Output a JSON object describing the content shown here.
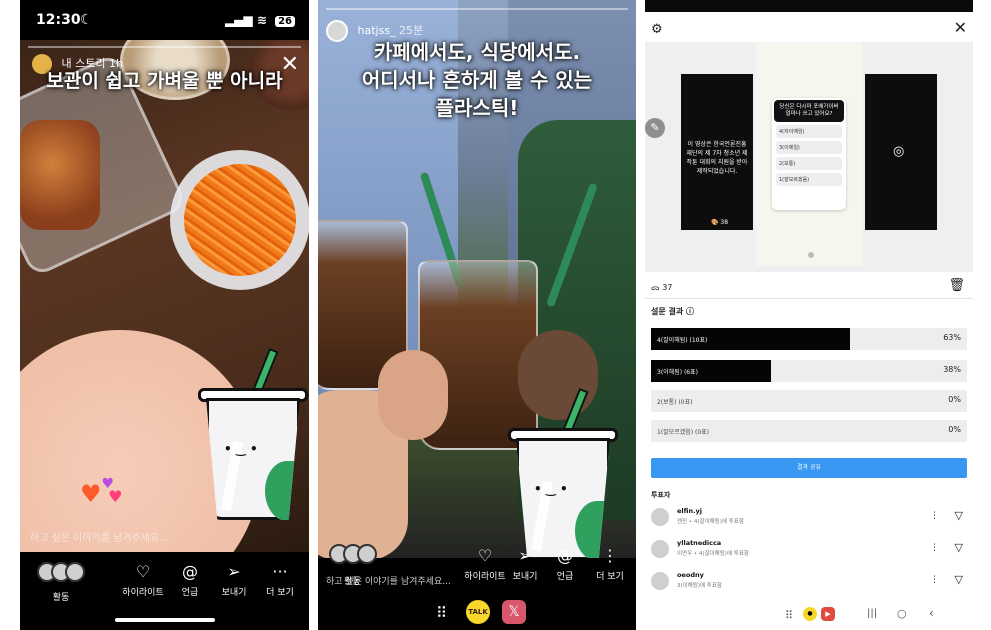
{
  "panel1": {
    "status": {
      "time": "12:30",
      "battery": "26"
    },
    "story_owner": "내 스토리",
    "story_time": "1h",
    "caption": "보관이 쉽고 가벼울 뿐 아니라",
    "message_placeholder": "하고 싶은 이야기를 남겨주세요...",
    "actions": [
      {
        "icon": "activity-avatars-icon",
        "label": "활동"
      },
      {
        "icon": "highlight-icon",
        "label": "하이라이트"
      },
      {
        "icon": "mention-icon",
        "label": "언급"
      },
      {
        "icon": "send-icon",
        "label": "보내기"
      },
      {
        "icon": "more-icon",
        "label": "더 보기"
      }
    ]
  },
  "panel2": {
    "username": "hatjss_",
    "time": "25분",
    "caption_lines": [
      "카페에서도, 식당에서도.",
      "어디서나 흔하게 볼 수 있는",
      "플라스틱!"
    ],
    "message_placeholder": "하고 싶은 이야기를 남겨주세요...",
    "activity_label": "활동",
    "actions": [
      {
        "icon": "highlight-icon",
        "label": "하이라이트"
      },
      {
        "icon": "send-icon",
        "label": "보내기"
      },
      {
        "icon": "mention-icon",
        "label": "언급"
      },
      {
        "icon": "more-icon",
        "label": "더 보기"
      }
    ],
    "nav": {
      "talk_label": "TALK"
    }
  },
  "panel3": {
    "thumb_left_text": "이 영상은 한국언론진흥재단의 제 7차 청소년 제작툰 대회의 지원을 받아 제작되었습니다.",
    "thumb_left_count": "🎨 38",
    "poll_question": "당신은 다시마 포에가이버 얼마나 쓰고 있어요?",
    "poll_options": [
      "4(자이예임)",
      "3(이메일)",
      "2(보통)",
      "1(잘모르겠음)"
    ],
    "views": "37",
    "results_title": "설문 결과",
    "results": [
      {
        "label": "4(잘이해됨) (10표)",
        "percent": "63%",
        "value": 63
      },
      {
        "label": "3(이해됨) (6표)",
        "percent": "38%",
        "value": 38
      },
      {
        "label": "2(보통) (0표)",
        "percent": "0%",
        "value": 0
      },
      {
        "label": "1(잘모르겠음) (0표)",
        "percent": "0%",
        "value": 0
      }
    ],
    "share_button": "결과 공유",
    "voters_title": "투표자",
    "voters": [
      {
        "name": "elfin.yj",
        "sub": "엔진 • 4(잘이해됨)에 투표함"
      },
      {
        "name": "yllatnedicca",
        "sub": "이연우 • 4(잘이해됨)에 투표함"
      },
      {
        "name": "oeodny",
        "sub": "3(이해됨)에 투표함"
      }
    ]
  }
}
